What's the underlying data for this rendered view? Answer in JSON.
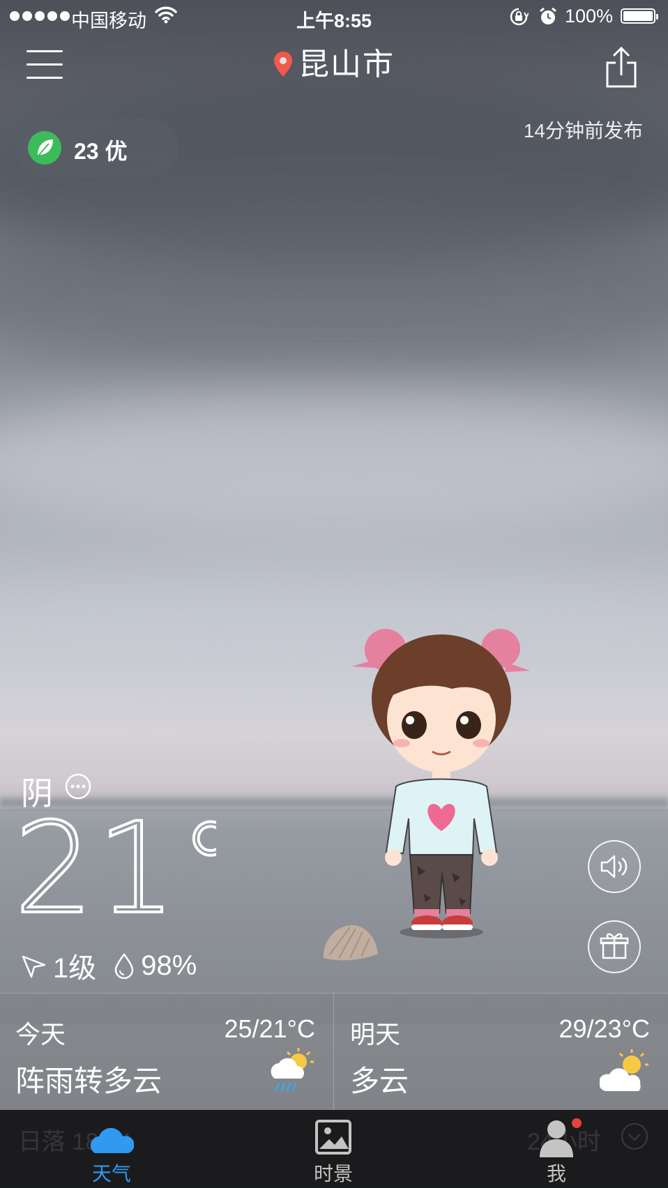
{
  "status_bar": {
    "carrier": "中国移动",
    "time": "上午8:55",
    "battery_percent": "100%",
    "battery_level": 1.0
  },
  "header": {
    "location": "昆山市",
    "publish_time": "14分钟前发布"
  },
  "aqi": {
    "label": "23 优",
    "color": "#3dbb5a"
  },
  "current": {
    "condition": "阴",
    "temperature": "21°",
    "wind": "1级",
    "humidity": "98%"
  },
  "forecast": [
    {
      "day": "今天",
      "range": "25/21°C",
      "desc": "阵雨转多云",
      "icon": "sun-cloud-rain-icon"
    },
    {
      "day": "明天",
      "range": "29/23°C",
      "desc": "多云",
      "icon": "sun-cloud-icon"
    }
  ],
  "tabbar": {
    "behind_left": "日落 18:34",
    "behind_right": "24小时",
    "tabs": [
      {
        "label": "天气",
        "icon": "cloud-icon",
        "active": true
      },
      {
        "label": "时景",
        "icon": "picture-icon",
        "active": false
      },
      {
        "label": "我",
        "icon": "person-icon",
        "active": false
      }
    ]
  },
  "colors": {
    "accent": "#2f9af0",
    "pin": "#f05a4a",
    "badge": "#e8433a"
  }
}
